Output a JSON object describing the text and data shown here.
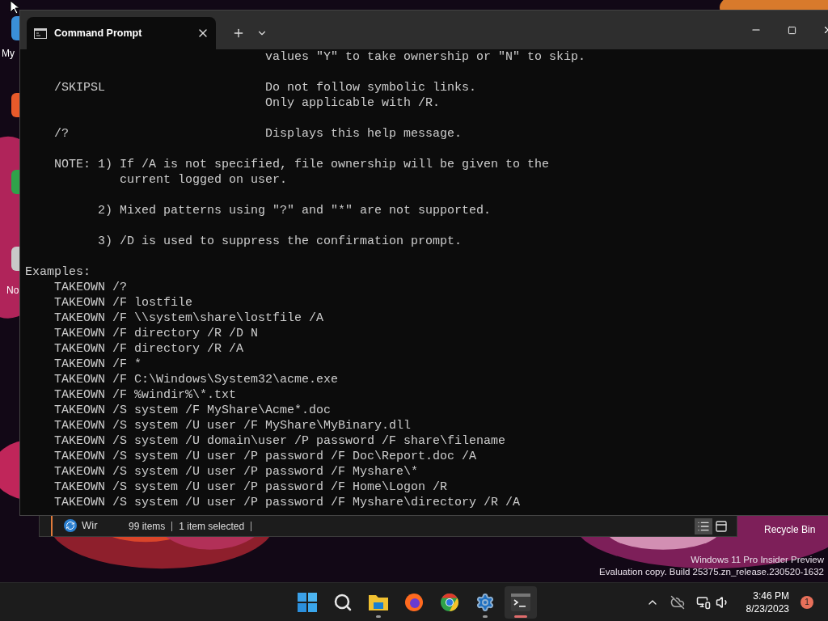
{
  "desktop": {
    "icons": [
      {
        "label": "My"
      },
      {
        "label": "No"
      }
    ],
    "recycle_bin": "Recycle Bin",
    "build_info": [
      "Windows 11 Pro Insider Preview",
      "Evaluation copy. Build 25375.zn_release.230520-1632"
    ]
  },
  "explorer": {
    "nav_item": "Wir",
    "status": [
      "99 items",
      "1 item selected"
    ],
    "views": [
      {
        "kind": "details",
        "selected": true
      },
      {
        "kind": "tiles",
        "selected": false
      }
    ]
  },
  "terminal": {
    "tabs": [
      {
        "title": "Command Prompt",
        "selected": true
      }
    ],
    "blocks": [
      [
        "                                 values \"Y\" to take ownership or \"N\" to skip."
      ],
      [
        "    /SKIPSL                      Do not follow symbolic links.",
        "                                 Only applicable with /R."
      ],
      [
        "    /?                           Displays this help message."
      ],
      [
        "    NOTE: 1) If /A is not specified, file ownership will be given to the",
        "             current logged on user."
      ],
      [
        "          2) Mixed patterns using \"?\" and \"*\" are not supported."
      ],
      [
        "          3) /D is used to suppress the confirmation prompt."
      ],
      [
        "Examples:",
        "    TAKEOWN /?",
        "    TAKEOWN /F lostfile",
        "    TAKEOWN /F \\\\system\\share\\lostfile /A",
        "    TAKEOWN /F directory /R /D N",
        "    TAKEOWN /F directory /R /A",
        "    TAKEOWN /F *",
        "    TAKEOWN /F C:\\Windows\\System32\\acme.exe",
        "    TAKEOWN /F %windir%\\*.txt",
        "    TAKEOWN /S system /F MyShare\\Acme*.doc",
        "    TAKEOWN /S system /U user /F MyShare\\MyBinary.dll",
        "    TAKEOWN /S system /U domain\\user /P password /F share\\filename",
        "    TAKEOWN /S system /U user /P password /F Doc\\Report.doc /A",
        "    TAKEOWN /S system /U user /P password /F Myshare\\*",
        "    TAKEOWN /S system /U user /P password /F Home\\Logon /R",
        "    TAKEOWN /S system /U user /P password /F Myshare\\directory /R /A"
      ]
    ]
  },
  "taskbar": {
    "apps": [
      {
        "kind": "start",
        "running": false,
        "selected": false
      },
      {
        "kind": "search",
        "running": false,
        "selected": false
      },
      {
        "kind": "files",
        "running": true,
        "selected": false
      },
      {
        "kind": "firefox",
        "running": false,
        "selected": false
      },
      {
        "kind": "chrome",
        "running": false,
        "selected": false
      },
      {
        "kind": "settings",
        "running": true,
        "selected": false
      },
      {
        "kind": "terminal",
        "running": true,
        "selected": true
      }
    ],
    "clock": {
      "time": "3:46 PM",
      "date": "8/23/2023"
    },
    "notifications": "1"
  }
}
